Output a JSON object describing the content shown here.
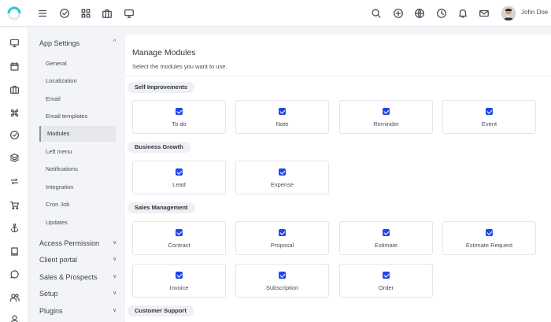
{
  "user": {
    "name": "John Doe"
  },
  "topbar": {
    "left_icons": [
      "menu-icon",
      "check-circle-icon",
      "grid-icon",
      "briefcase-icon",
      "monitor-icon"
    ],
    "right_icons": [
      "search-icon",
      "plus-circle-icon",
      "globe-icon",
      "clock-icon",
      "bell-icon",
      "mail-icon"
    ]
  },
  "iconbar": [
    "monitor-icon",
    "calendar-icon",
    "briefcase-icon",
    "command-icon",
    "check-circle-icon",
    "layers-icon",
    "repeat-icon",
    "cart-icon",
    "anchor-icon",
    "book-icon",
    "chat-icon",
    "users-icon",
    "user-icon"
  ],
  "settings_nav": {
    "app_settings": {
      "label": "App Settings",
      "caret": "^",
      "items": [
        "General",
        "Localization",
        "Email",
        "Email templates",
        "Modules",
        "Left menu",
        "Notifications",
        "Integration",
        "Cron Job",
        "Updates"
      ],
      "active": "Modules"
    },
    "sections": [
      {
        "label": "Access Permission",
        "caret": "v"
      },
      {
        "label": "Client portal",
        "caret": "v"
      },
      {
        "label": "Sales & Prospects",
        "caret": "v"
      },
      {
        "label": "Setup",
        "caret": "v"
      },
      {
        "label": "Plugins",
        "caret": "v"
      }
    ]
  },
  "main": {
    "title": "Manage Modules",
    "subtitle": "Select the modules you want to use.",
    "groups": [
      {
        "name": "Self Improvements",
        "modules": [
          {
            "label": "To do",
            "checked": true
          },
          {
            "label": "Note",
            "checked": true
          },
          {
            "label": "Reminder",
            "checked": true
          },
          {
            "label": "Event",
            "checked": true
          }
        ]
      },
      {
        "name": "Business Growth",
        "modules": [
          {
            "label": "Lead",
            "checked": true
          },
          {
            "label": "Expense",
            "checked": true
          }
        ]
      },
      {
        "name": "Sales Management",
        "modules": [
          {
            "label": "Contract",
            "checked": true
          },
          {
            "label": "Proposal",
            "checked": true
          },
          {
            "label": "Estimate",
            "checked": true
          },
          {
            "label": "Estimate Request",
            "checked": true
          },
          {
            "label": "Invoice",
            "checked": true
          },
          {
            "label": "Subscription",
            "checked": true
          },
          {
            "label": "Order",
            "checked": true
          }
        ]
      },
      {
        "name": "Customer Support",
        "modules": []
      }
    ]
  },
  "colors": {
    "accent": "#1f46e6",
    "logo": "#2ec4d6",
    "background": "#f3f4f7"
  }
}
